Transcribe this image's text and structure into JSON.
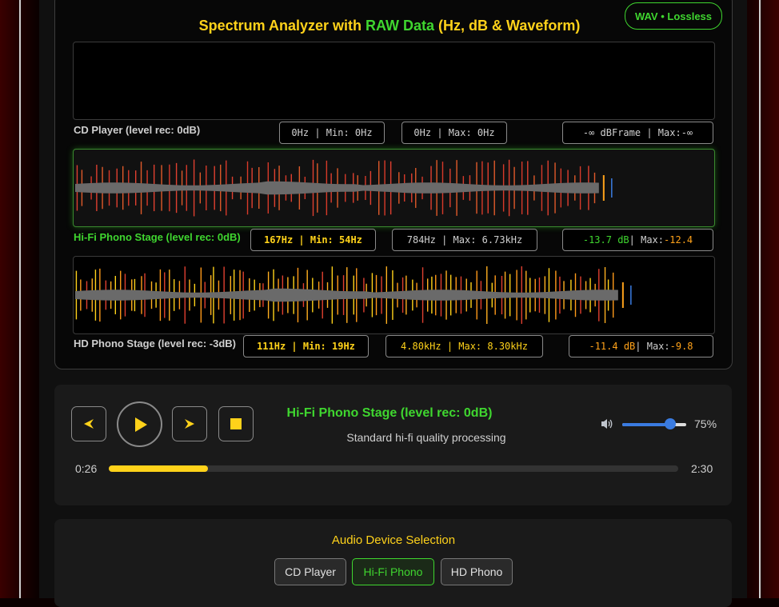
{
  "header": {
    "title_pre": "Spectrum Analyzer with ",
    "title_raw": "RAW Data",
    "title_post": " (Hz, dB & Waveform)",
    "badge": "WAV • Lossless"
  },
  "channels": [
    {
      "label": "CD Player (level rec: 0dB)",
      "active": false,
      "stats": [
        "0Hz | Min: 0Hz",
        "0Hz | Max: 0Hz"
      ],
      "db": {
        "value": "-∞ dB",
        "mid": " Frame | Max: ",
        "max": "-∞"
      },
      "waveform": null
    },
    {
      "label": "Hi-Fi Phono Stage (level rec: 0dB)",
      "active": true,
      "stats": [
        "167Hz | Min: 54Hz",
        "784Hz | Max: 6.73kHz"
      ],
      "db": {
        "value": "-13.7 dB",
        "mid": " | Max: ",
        "max": "-12.4"
      },
      "waveform": {
        "spikes": 80,
        "filled_fraction": 0.82,
        "spike_colors": [
          "#e04030",
          "#e05a2a",
          "#d83a2a"
        ]
      }
    },
    {
      "label": "HD Phono Stage (level rec: -3dB)",
      "active": false,
      "stats": [
        "111Hz | Min: 19Hz",
        "4.80kHz | Max: 8.30kHz"
      ],
      "db": {
        "value": "-11.4 dB",
        "mid": " | Max: ",
        "max": "-9.8"
      },
      "waveform": {
        "spikes": 110,
        "filled_fraction": 0.85,
        "spike_colors": [
          "#ffd21a",
          "#ff9a1a",
          "#e04030",
          "#ffb020"
        ]
      }
    }
  ],
  "player": {
    "now_title": "Hi-Fi Phono Stage (level rec: 0dB)",
    "now_sub": "Standard hi-fi quality processing",
    "time_current": "0:26",
    "time_total": "2:30",
    "progress": 0.174,
    "volume": 0.75,
    "volume_label": "75%"
  },
  "devices": {
    "heading": "Audio Device Selection",
    "buttons": [
      "CD Player",
      "Hi-Fi Phono",
      "HD Phono"
    ],
    "active_index": 1
  },
  "colors": {
    "accent_yellow": "#ffd21a",
    "accent_green": "#3fd62f",
    "accent_orange": "#ffa21a",
    "volume_blue": "#3a7be0"
  },
  "icons": [
    "previous-icon",
    "play-icon",
    "next-icon",
    "stop-icon",
    "speaker-icon"
  ]
}
